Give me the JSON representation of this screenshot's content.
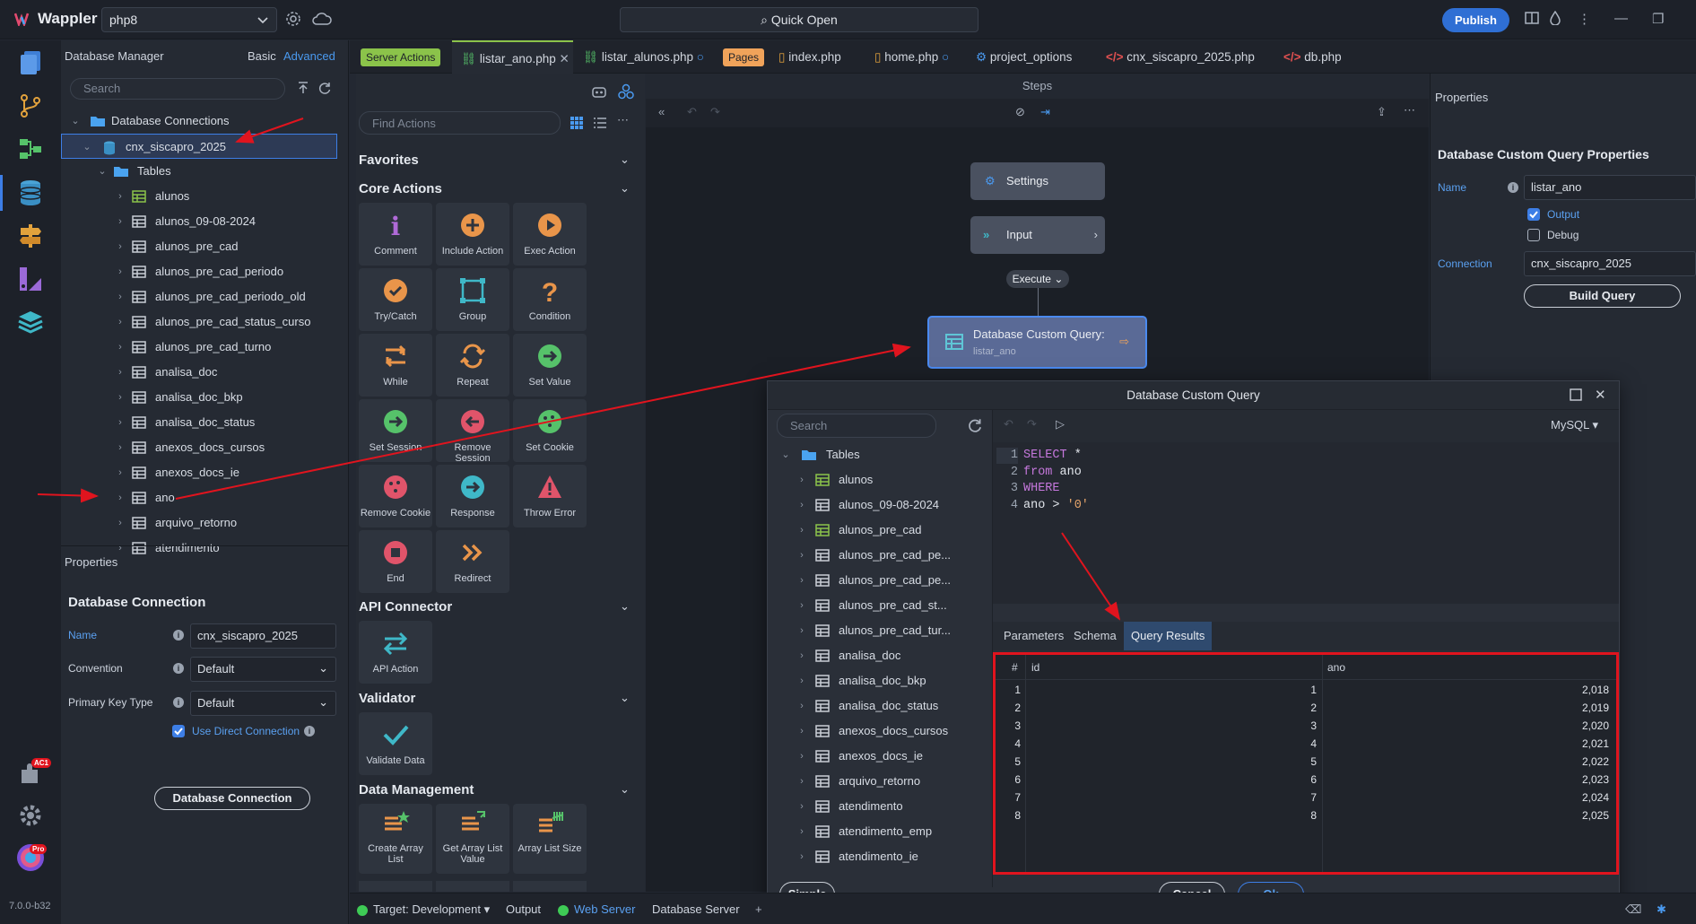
{
  "app": {
    "name": "Wappler",
    "project": "php8",
    "quick_open": "Quick Open",
    "publish": "Publish",
    "version": "7.0.0-b32"
  },
  "activity": {
    "badge_ac": "AC1",
    "badge_pro": "Pro"
  },
  "dbmanager": {
    "title": "Database Manager",
    "mode_basic": "Basic",
    "mode_advanced": "Advanced",
    "search_placeholder": "Search",
    "tree": {
      "root": "Database Connections",
      "connection": "cnx_siscapro_2025",
      "tables_folder": "Tables",
      "tables": [
        "alunos",
        "alunos_09-08-2024",
        "alunos_pre_cad",
        "alunos_pre_cad_periodo",
        "alunos_pre_cad_periodo_old",
        "alunos_pre_cad_status_curso",
        "alunos_pre_cad_turno",
        "analisa_doc",
        "analisa_doc_bkp",
        "analisa_doc_status",
        "anexos_docs_cursos",
        "anexos_docs_ie",
        "ano",
        "arquivo_retorno",
        "atendimento"
      ]
    }
  },
  "left_props": {
    "header": "Properties",
    "section": "Database Connection",
    "name_label": "Name",
    "name_value": "cnx_siscapro_2025",
    "convention_label": "Convention",
    "convention_value": "Default",
    "pk_label": "Primary Key Type",
    "pk_value": "Default",
    "direct_label": "Use Direct Connection",
    "button": "Database Connection"
  },
  "tabs": {
    "server_actions": "Server Actions",
    "listar_ano": "listar_ano.php",
    "listar_alunos": "listar_alunos.php",
    "pages": "Pages",
    "index": "index.php",
    "home": "home.php",
    "project_options": "project_options",
    "cnx": "cnx_siscapro_2025.php",
    "db": "db.php"
  },
  "palette": {
    "find_placeholder": "Find Actions",
    "favorites": "Favorites",
    "core": "Core Actions",
    "core_actions": [
      "Comment",
      "Include Action",
      "Exec Action",
      "Try/Catch",
      "Group",
      "Condition",
      "While",
      "Repeat",
      "Set Value",
      "Set Session",
      "Remove Session",
      "Set Cookie",
      "Remove Cookie",
      "Response",
      "Throw Error",
      "End",
      "Redirect"
    ],
    "api": "API Connector",
    "api_action": "API Action",
    "validator": "Validator",
    "validate_data": "Validate Data",
    "data_mgmt": "Data Management",
    "data_actions": [
      "Create Array List",
      "Get Array List Value",
      "Array List Size"
    ]
  },
  "steps": {
    "title": "Steps",
    "settings": "Settings",
    "input": "Input",
    "execute": "Execute",
    "query_title": "Database Custom Query:",
    "query_name": "listar_ano"
  },
  "right_props": {
    "header": "Properties",
    "section": "Database Custom Query Properties",
    "name_label": "Name",
    "name_value": "listar_ano",
    "output": "Output",
    "debug": "Debug",
    "connection_label": "Connection",
    "connection_value": "cnx_siscapro_2025",
    "build": "Build Query"
  },
  "dialog": {
    "title": "Database Custom Query",
    "search_placeholder": "Search",
    "dialect": "MySQL",
    "tables_folder": "Tables",
    "tables": [
      "alunos",
      "alunos_09-08-2024",
      "alunos_pre_cad",
      "alunos_pre_cad_pe...",
      "alunos_pre_cad_pe...",
      "alunos_pre_cad_st...",
      "alunos_pre_cad_tur...",
      "analisa_doc",
      "analisa_doc_bkp",
      "analisa_doc_status",
      "anexos_docs_cursos",
      "anexos_docs_ie",
      "arquivo_retorno",
      "atendimento",
      "atendimento_emp",
      "atendimento_ie"
    ],
    "sql": [
      {
        "n": "1",
        "kw": "SELECT",
        "rest": " *"
      },
      {
        "n": "2",
        "kw": "from",
        "rest": " ano"
      },
      {
        "n": "3",
        "kw": "WHERE",
        "rest": ""
      },
      {
        "n": "4",
        "kw": "",
        "rest": "ano > ",
        "str": "'0'"
      }
    ],
    "qtabs": [
      "Parameters",
      "Schema",
      "Query Results"
    ],
    "columns": [
      "#",
      "id",
      "ano"
    ],
    "rows": [
      [
        "1",
        "1",
        "2,018"
      ],
      [
        "2",
        "2",
        "2,019"
      ],
      [
        "3",
        "3",
        "2,020"
      ],
      [
        "4",
        "4",
        "2,021"
      ],
      [
        "5",
        "5",
        "2,022"
      ],
      [
        "6",
        "6",
        "2,023"
      ],
      [
        "7",
        "7",
        "2,024"
      ],
      [
        "8",
        "8",
        "2,025"
      ]
    ],
    "simple": "Simple",
    "cancel": "Cancel",
    "ok": "Ok"
  },
  "status": {
    "target": "Target: Development",
    "output": "Output",
    "web_server": "Web Server",
    "db_server": "Database Server"
  },
  "colors": {
    "accent": "#3d7ee6",
    "highlight": "#e0141e",
    "success": "#3ecb55",
    "tag_green": "#8bc34a",
    "tag_orange": "#f0a35a"
  }
}
